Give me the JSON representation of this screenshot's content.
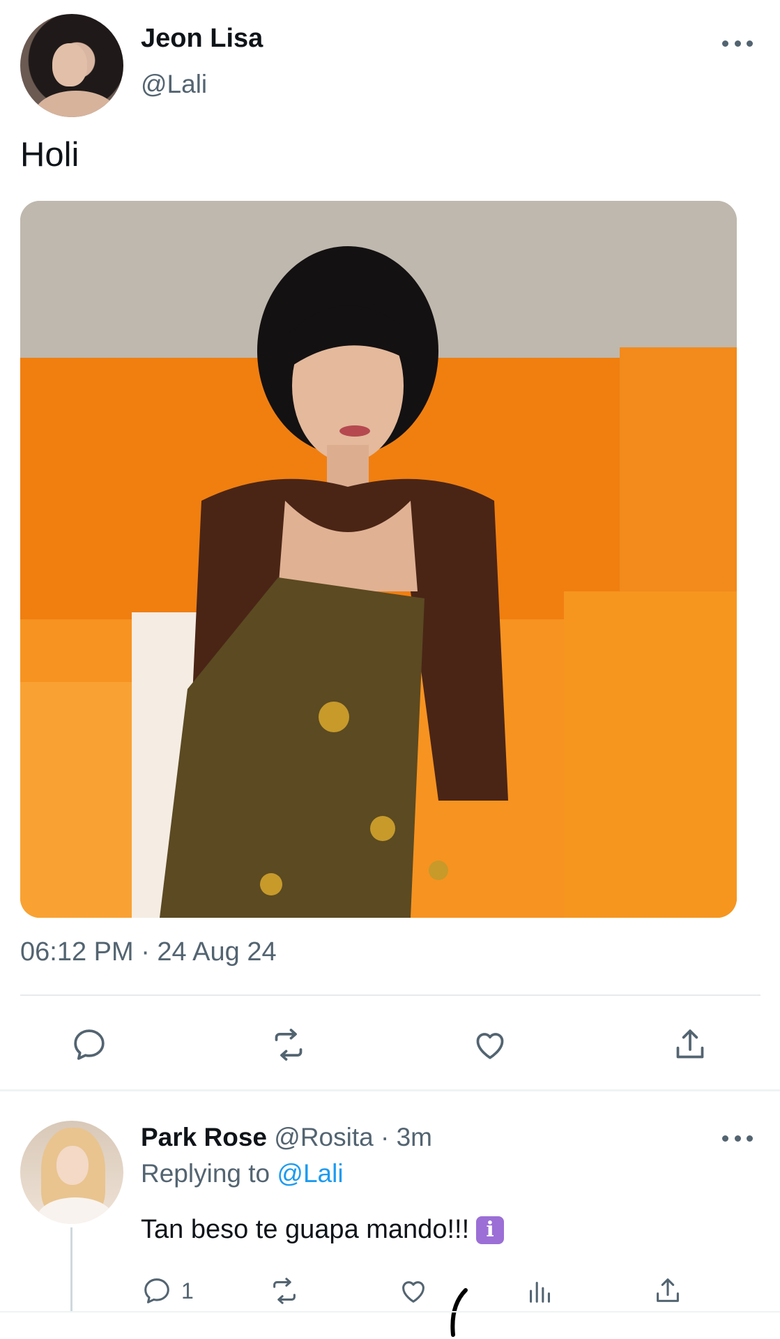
{
  "tweet": {
    "author_name": "Jeon Lisa",
    "author_handle": "@Lali",
    "text": "Holi",
    "timestamp": "06:12 PM · 24 Aug 24",
    "media_description_icon": "photo"
  },
  "actions": {
    "reply_icon": "reply-icon",
    "retweet_icon": "retweet-icon",
    "like_icon": "like-icon",
    "share_icon": "share-icon"
  },
  "reply": {
    "author_name": "Park Rose",
    "meta": " @Rosita · 3m",
    "replying_to_label": "Replying to ",
    "replying_to_handle": "@Lali",
    "text": "Tan beso te guapa mando!!! ",
    "emoji": "i",
    "reply_count": "1"
  },
  "colors": {
    "text_primary": "#0f1419",
    "text_secondary": "#536471",
    "mention": "#1d9bf0",
    "divider": "#e7e9ea"
  }
}
